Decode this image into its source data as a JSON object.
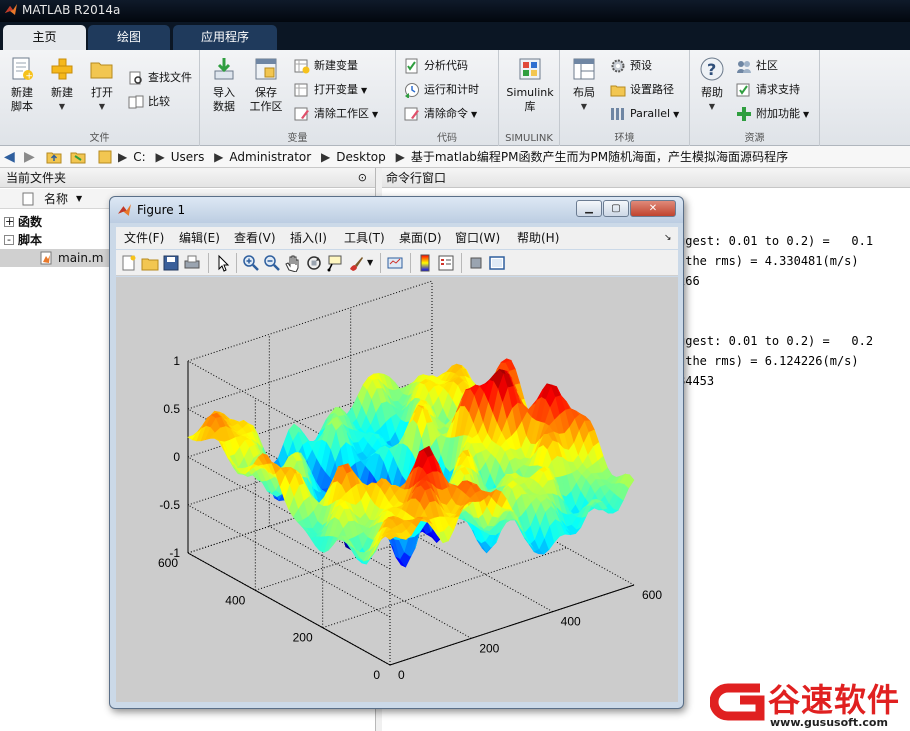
{
  "app": {
    "window_title": "MATLAB R2014a",
    "tabs": [
      {
        "label": "主页",
        "active": true
      },
      {
        "label": "绘图",
        "active": false
      },
      {
        "label": "应用程序",
        "active": false
      }
    ]
  },
  "toolstrip": {
    "file_group": {
      "label": "文件",
      "new_script": "新建\n脚本",
      "new": "新建",
      "open": "打开",
      "find_files": "查找文件",
      "compare": "比较"
    },
    "variable_group": {
      "label": "变量",
      "import_data": "导入\n数据",
      "save_workspace": "保存\n工作区",
      "new_variable": "新建变量",
      "open_variable": "打开变量",
      "clear_workspace": "清除工作区"
    },
    "code_group": {
      "label": "代码",
      "analyze_code": "分析代码",
      "run_and_time": "运行和计时",
      "clear_commands": "清除命令"
    },
    "simulink_group": {
      "label": "SIMULINK",
      "simulink_library": "Simulink\n库"
    },
    "environment_group": {
      "label": "环境",
      "layout": "布局",
      "preferences": "预设",
      "set_path": "设置路径",
      "parallel": "Parallel"
    },
    "resources_group": {
      "label": "资源",
      "help": "帮助",
      "community": "社区",
      "request_support": "请求支持",
      "addons": "附加功能"
    }
  },
  "address_bar": {
    "path": [
      "C:",
      "Users",
      "Administrator",
      "Desktop",
      "基于matlab编程PM函数产生而为PM随机海面，产生模拟海面源码程序"
    ]
  },
  "current_folder": {
    "title": "当前文件夹",
    "column_name": "名称",
    "items": [
      {
        "label": "函数",
        "kind": "folder",
        "toggle": "+"
      },
      {
        "label": "脚本",
        "kind": "folder",
        "toggle": "-"
      },
      {
        "label": "main.m",
        "kind": "file"
      }
    ]
  },
  "command_window": {
    "title": "命令行窗口",
    "lines": [
      "ggest: 0.01 to 0.2) =   0.1",
      " the rms) = 4.330481(m/s)",
      "266",
      "ggest: 0.01 to 0.2) =   0.2",
      " the rms) = 6.124226(m/s)",
      "84453"
    ]
  },
  "figure": {
    "title": "Figure 1",
    "menu": [
      "文件(F)",
      "编辑(E)",
      "查看(V)",
      "插入(I)",
      "工具(T)",
      "桌面(D)",
      "窗口(W)",
      "帮助(H)"
    ],
    "z_ticks": [
      "1",
      "0.5",
      "0",
      "-0.5",
      "-1"
    ],
    "y_ticks": [
      "600",
      "400",
      "200",
      "0"
    ],
    "x_ticks": [
      "0",
      "200",
      "400",
      "600"
    ],
    "colormap": [
      "#00008f",
      "#0000ff",
      "#0080ff",
      "#00ffff",
      "#80ff80",
      "#ffff00",
      "#ff8000",
      "#ff0000",
      "#800000"
    ]
  },
  "watermark": {
    "brand": "谷速软件",
    "url": "www.gususoft.com",
    "color": "#e02020"
  }
}
